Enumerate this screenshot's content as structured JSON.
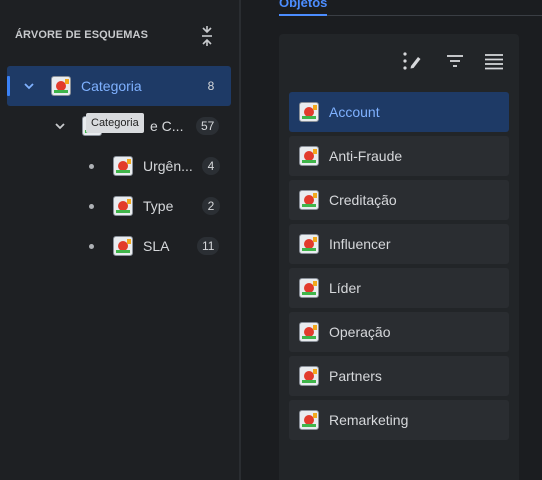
{
  "tree": {
    "header": "ÁRVORE DE ESQUEMAS",
    "nodes": [
      {
        "label": "Categoria",
        "count": "8"
      },
      {
        "label": "e C...",
        "count": "57"
      },
      {
        "label": "Urgên...",
        "count": "4"
      },
      {
        "label": "Type",
        "count": "2"
      },
      {
        "label": "SLA",
        "count": "11"
      }
    ],
    "tooltip": "Categoria"
  },
  "objects": {
    "tab": "Objetos",
    "items": [
      "Account",
      "Anti-Fraude",
      "Creditação",
      "Influencer",
      "Líder",
      "Operação",
      "Partners",
      "Remarketing"
    ]
  },
  "colors": {
    "accent": "#4c8dff",
    "selected_bg": "#1e3a66"
  }
}
